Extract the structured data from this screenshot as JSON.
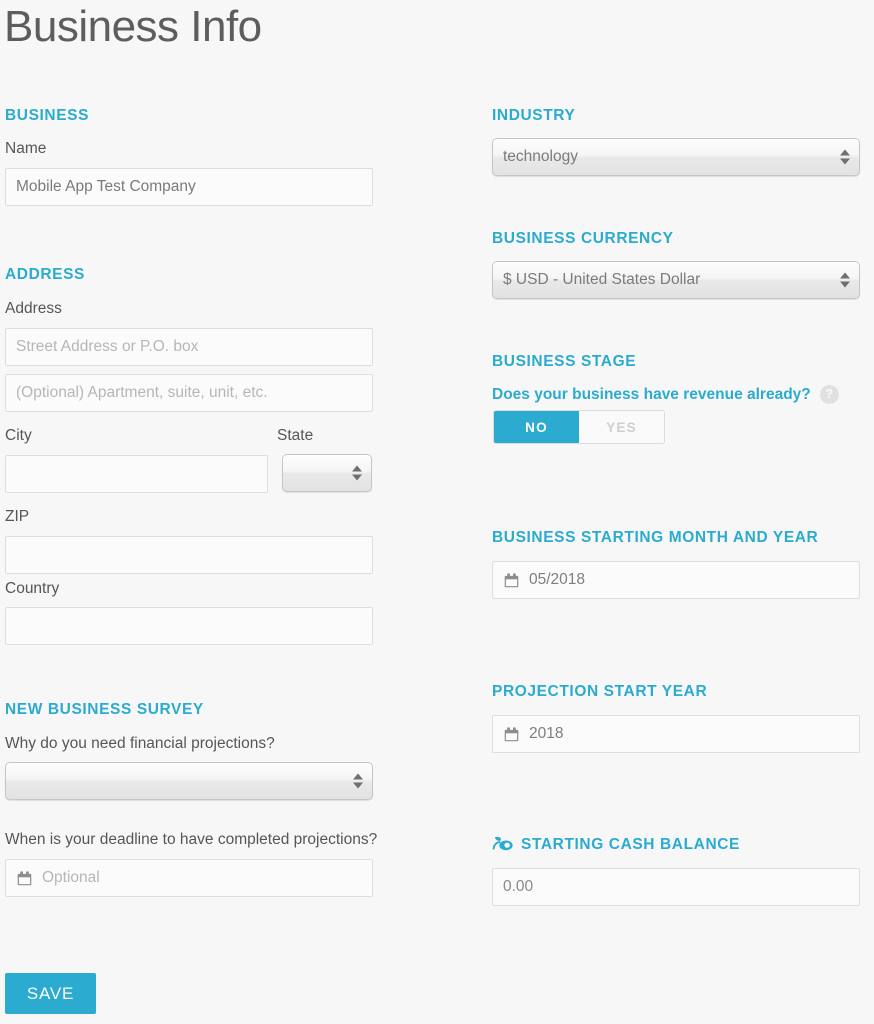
{
  "page": {
    "title": "Business Info",
    "accent_color": "#2aabcf",
    "background_color": "#f7f7f8"
  },
  "left": {
    "business": {
      "heading": "BUSINESS",
      "name_label": "Name",
      "name_value": "Mobile App Test Company"
    },
    "address": {
      "heading": "ADDRESS",
      "address_label": "Address",
      "street_placeholder": "Street Address or P.O. box",
      "apt_placeholder": "(Optional) Apartment, suite, unit, etc.",
      "city_label": "City",
      "city_value": "",
      "state_label": "State",
      "state_value": "",
      "zip_label": "ZIP",
      "zip_value": "",
      "country_label": "Country",
      "country_value": ""
    },
    "survey": {
      "heading": "NEW BUSINESS SURVEY",
      "why_label": "Why do you need financial projections?",
      "why_value": "",
      "deadline_label": "When is your deadline to have completed projections?",
      "deadline_placeholder": "Optional"
    }
  },
  "right": {
    "industry": {
      "heading": "INDUSTRY",
      "value": "technology"
    },
    "currency": {
      "heading": "BUSINESS CURRENCY",
      "value": "$ USD - United States Dollar"
    },
    "stage": {
      "heading": "BUSINESS STAGE",
      "question": "Does your business have revenue already?",
      "help_glyph": "?",
      "options": [
        "NO",
        "YES"
      ],
      "selected": "NO"
    },
    "start_month_year": {
      "heading": "BUSINESS STARTING MONTH AND YEAR",
      "value": "05/2018"
    },
    "projection_start_year": {
      "heading": "PROJECTION START YEAR",
      "value": "2018"
    },
    "starting_cash": {
      "heading": "STARTING CASH BALANCE",
      "icon": "sprout-icon",
      "value": "0.00"
    }
  },
  "footer": {
    "save_label": "SAVE"
  },
  "icons": {
    "calendar": "calendar-icon",
    "sprout": "sprout-icon",
    "help": "help-circle-icon",
    "select_spinner": "spinner-arrows-icon"
  }
}
